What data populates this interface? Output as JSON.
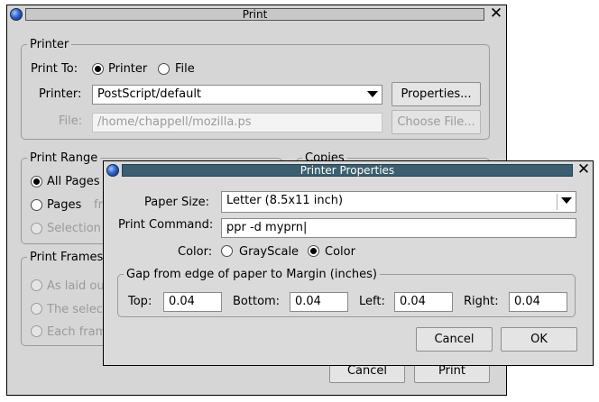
{
  "print_dialog": {
    "title": "Print",
    "printer_group": {
      "legend": "Printer",
      "print_to_label": "Print To:",
      "radio_printer": "Printer",
      "radio_file": "File",
      "printer_label": "Printer:",
      "printer_value": "PostScript/default",
      "properties_button": "Properties...",
      "file_label": "File:",
      "file_value": "/home/chappell/mozilla.ps",
      "choose_file_button": "Choose File..."
    },
    "print_range_group": {
      "legend": "Print Range",
      "all_pages": "All Pages",
      "pages": "Pages",
      "pages_from": "fr",
      "selection": "Selection"
    },
    "copies_group": {
      "legend": "Copies"
    },
    "print_frames_group": {
      "legend": "Print Frames",
      "as_laid_out": "As laid ou",
      "selected": "The selec",
      "each_frame": "Each fram"
    },
    "cancel_button": "Cancel",
    "print_button": "Print"
  },
  "properties_dialog": {
    "title": "Printer Properties",
    "paper_size_label": "Paper Size:",
    "paper_size_value": "Letter (8.5x11 inch)",
    "print_command_label": "Print Command:",
    "print_command_value": "ppr -d myprn",
    "color_label": "Color:",
    "grayscale": "GrayScale",
    "color": "Color",
    "margin_group": {
      "legend": "Gap from edge of paper to Margin (inches)",
      "top_label": "Top:",
      "top_value": "0.04",
      "bottom_label": "Bottom:",
      "bottom_value": "0.04",
      "left_label": "Left:",
      "left_value": "0.04",
      "right_label": "Right:",
      "right_value": "0.04"
    },
    "cancel_button": "Cancel",
    "ok_button": "OK"
  },
  "colors": {
    "dialog_bg": "#d6d6d6",
    "active_titlebar": "#3b5f70",
    "inactive_titlebar": "#c8c8c8",
    "disabled_text": "#9a9a9a"
  }
}
